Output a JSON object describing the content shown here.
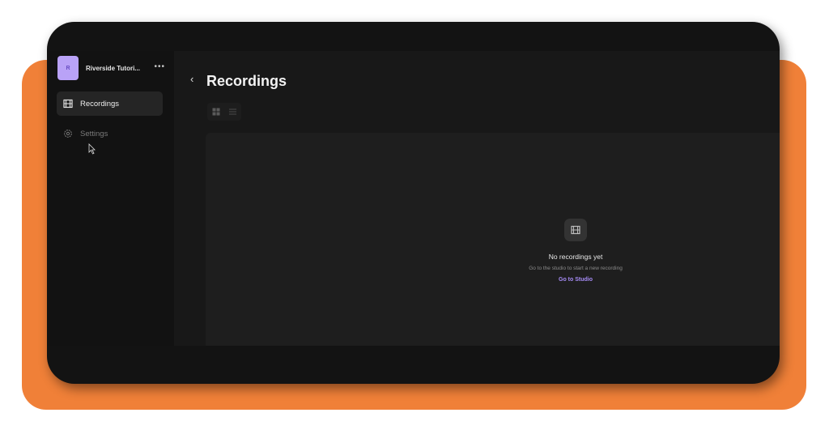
{
  "workspace": {
    "avatar_letter": "R",
    "name": "Riverside Tutori...",
    "more": "•••"
  },
  "sidebar": {
    "items": [
      {
        "label": "Recordings",
        "icon": "film-icon",
        "active": true
      },
      {
        "label": "Settings",
        "icon": "gear-icon",
        "active": false
      }
    ]
  },
  "header": {
    "back": "‹",
    "title": "Recordings"
  },
  "view_toggle": {
    "options": [
      "grid-view-icon",
      "list-view-icon"
    ]
  },
  "empty_state": {
    "icon": "film-icon",
    "title": "No recordings yet",
    "subtitle": "Go to the studio to start a new recording",
    "link": "Go to Studio"
  },
  "colors": {
    "accent": "#a68bf5",
    "backdrop": "#f08038",
    "avatar": "#b9a2f7"
  }
}
